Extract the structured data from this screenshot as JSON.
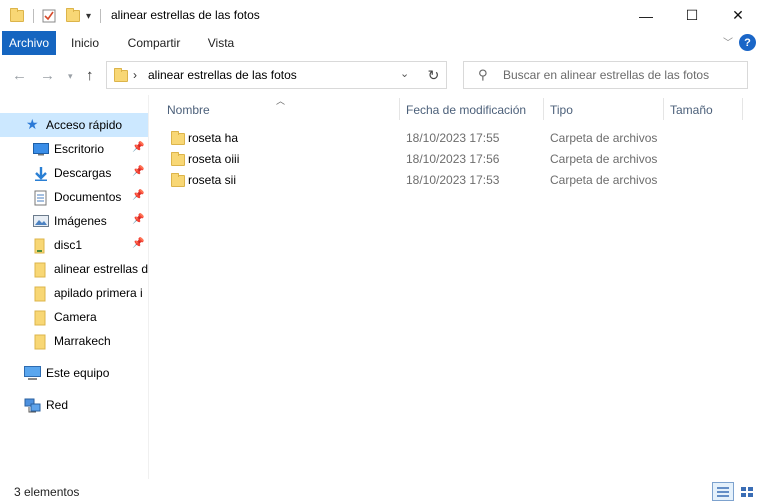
{
  "window": {
    "title": "alinear estrellas de las fotos",
    "minimize_glyph": "—",
    "maximize_glyph": "☐",
    "close_glyph": "✕"
  },
  "ribbon": {
    "tabs": [
      {
        "label": "Archivo",
        "active": true
      },
      {
        "label": "Inicio",
        "active": false
      },
      {
        "label": "Compartir",
        "active": false
      },
      {
        "label": "Vista",
        "active": false
      }
    ],
    "help_label": "?"
  },
  "address": {
    "path": "alinear estrellas de las fotos",
    "separator": "›"
  },
  "search": {
    "placeholder": "Buscar en alinear estrellas de las fotos"
  },
  "nav": {
    "quick_access": "Acceso rápido",
    "items": [
      {
        "label": "Escritorio",
        "icon": "desktop-icon",
        "pinned": true
      },
      {
        "label": "Descargas",
        "icon": "download-icon",
        "pinned": true
      },
      {
        "label": "Documentos",
        "icon": "documents-icon",
        "pinned": true
      },
      {
        "label": "Imágenes",
        "icon": "pictures-icon",
        "pinned": true
      },
      {
        "label": "disc1",
        "icon": "folder-icon",
        "pinned": true
      },
      {
        "label": "alinear estrellas de",
        "icon": "folder-icon",
        "pinned": false
      },
      {
        "label": "apilado primera i",
        "icon": "folder-icon",
        "pinned": false
      },
      {
        "label": "Camera",
        "icon": "folder-icon",
        "pinned": false
      },
      {
        "label": "Marrakech",
        "icon": "folder-icon",
        "pinned": false
      }
    ],
    "this_pc": "Este equipo",
    "network": "Red"
  },
  "columns": {
    "name": "Nombre",
    "modified": "Fecha de modificación",
    "type": "Tipo",
    "size": "Tamaño"
  },
  "files": [
    {
      "name": "roseta ha",
      "modified": "18/10/2023 17:55",
      "type": "Carpeta de archivos"
    },
    {
      "name": "roseta oiii",
      "modified": "18/10/2023 17:56",
      "type": "Carpeta de archivos"
    },
    {
      "name": "roseta sii",
      "modified": "18/10/2023 17:53",
      "type": "Carpeta de archivos"
    }
  ],
  "status": {
    "count": "3 elementos"
  },
  "colors": {
    "accent": "#1565c0",
    "selection": "#cce8ff",
    "folder": "#f8d775"
  }
}
